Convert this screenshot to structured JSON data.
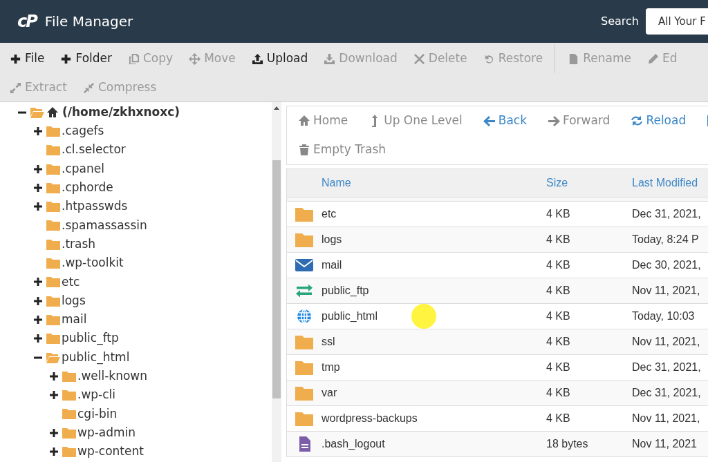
{
  "header": {
    "logo": "cP",
    "title": "File Manager",
    "search_label": "Search",
    "search_value": "All Your F"
  },
  "toolbar": [
    {
      "kind": "plus",
      "label": "File",
      "enabled": true
    },
    {
      "kind": "plus",
      "label": "Folder",
      "enabled": true
    },
    {
      "kind": "copy",
      "label": "Copy",
      "enabled": false
    },
    {
      "kind": "move",
      "label": "Move",
      "enabled": false
    },
    {
      "kind": "upload",
      "label": "Upload",
      "enabled": true
    },
    {
      "kind": "download",
      "label": "Download",
      "enabled": false
    },
    {
      "kind": "close",
      "label": "Delete",
      "enabled": false
    },
    {
      "kind": "restore",
      "label": "Restore",
      "enabled": false
    },
    {
      "kind": "file",
      "label": "Rename",
      "enabled": false,
      "separator_before": true
    },
    {
      "kind": "pencil",
      "label": "Ed",
      "enabled": false
    },
    {
      "kind": "extract",
      "label": "Extract",
      "enabled": false
    },
    {
      "kind": "compress",
      "label": "Compress",
      "enabled": false
    }
  ],
  "tree": [
    {
      "label": "(/home/zkhxnoxc)",
      "kind": "expanded",
      "home": true,
      "children": [
        {
          "label": ".cagefs",
          "kind": "collapsed"
        },
        {
          "label": ".cl.selector",
          "kind": "leaf"
        },
        {
          "label": ".cpanel",
          "kind": "collapsed"
        },
        {
          "label": ".cphorde",
          "kind": "collapsed"
        },
        {
          "label": ".htpasswds",
          "kind": "collapsed"
        },
        {
          "label": ".spamassassin",
          "kind": "leaf"
        },
        {
          "label": ".trash",
          "kind": "leaf"
        },
        {
          "label": ".wp-toolkit",
          "kind": "leaf"
        },
        {
          "label": "etc",
          "kind": "collapsed"
        },
        {
          "label": "logs",
          "kind": "collapsed"
        },
        {
          "label": "mail",
          "kind": "collapsed"
        },
        {
          "label": "public_ftp",
          "kind": "collapsed"
        },
        {
          "label": "public_html",
          "kind": "expanded",
          "children": [
            {
              "label": ".well-known",
              "kind": "collapsed"
            },
            {
              "label": ".wp-cli",
              "kind": "collapsed"
            },
            {
              "label": "cgi-bin",
              "kind": "leaf"
            },
            {
              "label": "wp-admin",
              "kind": "collapsed"
            },
            {
              "label": "wp-content",
              "kind": "collapsed"
            }
          ]
        }
      ]
    }
  ],
  "nav": [
    {
      "kind": "home",
      "label": "Home",
      "enabled": false
    },
    {
      "kind": "up",
      "label": "Up One Level",
      "enabled": false
    },
    {
      "kind": "back",
      "label": "Back",
      "enabled": true
    },
    {
      "kind": "forward",
      "label": "Forward",
      "enabled": false
    },
    {
      "kind": "reload",
      "label": "Reload",
      "enabled": true
    },
    {
      "kind": "checkbox",
      "enabled": true
    },
    {
      "kind": "trash",
      "label": "Empty Trash",
      "enabled": false
    }
  ],
  "table": {
    "columns": [
      "Name",
      "Size",
      "Last Modified"
    ],
    "rows": [
      {
        "kind": "folder",
        "name": "etc",
        "size": "4 KB",
        "modified": "Dec 31, 2021,"
      },
      {
        "kind": "folder",
        "name": "logs",
        "size": "4 KB",
        "modified": "Today, 8:24 P"
      },
      {
        "kind": "mail",
        "name": "mail",
        "size": "4 KB",
        "modified": "Dec 30, 2021,"
      },
      {
        "kind": "ftp",
        "name": "public_ftp",
        "size": "4 KB",
        "modified": "Nov 11, 2021,"
      },
      {
        "kind": "web",
        "name": "public_html",
        "size": "4 KB",
        "modified": "Today, 10:03"
      },
      {
        "kind": "folder",
        "name": "ssl",
        "size": "4 KB",
        "modified": "Nov 11, 2021,"
      },
      {
        "kind": "folder",
        "name": "tmp",
        "size": "4 KB",
        "modified": "Dec 31, 2021,"
      },
      {
        "kind": "folder",
        "name": "var",
        "size": "4 KB",
        "modified": "Dec 31, 2021,"
      },
      {
        "kind": "folder",
        "name": "wordpress-backups",
        "size": "4 KB",
        "modified": "Nov 11, 2021,"
      },
      {
        "kind": "file",
        "name": ".bash_logout",
        "size": "18 bytes",
        "modified": "Nov 11, 2021"
      }
    ]
  }
}
